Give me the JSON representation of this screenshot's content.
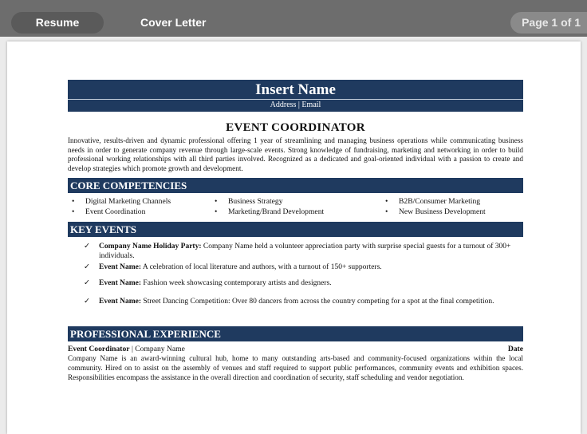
{
  "toolbar": {
    "tab_resume": "Resume",
    "tab_cover_letter": "Cover Letter",
    "page_indicator": "Page 1 of 1"
  },
  "resume": {
    "name": "Insert Name",
    "address_email": "Address | Email",
    "title": "EVENT COORDINATOR",
    "summary": "Innovative, results-driven and dynamic professional offering 1 year of streamlining and managing business operations while communicating business needs in order to generate company revenue through large-scale events. Strong knowledge of fundraising, marketing and networking in order to build professional working relationships with all third parties involved. Recognized as a dedicated and goal-oriented individual with a passion to create and develop strategies which promote growth and development.",
    "core_heading": "CORE COMPETENCIES",
    "competencies": [
      [
        "Digital Marketing Channels",
        "Event Coordination"
      ],
      [
        "Business Strategy",
        "Marketing/Brand Development"
      ],
      [
        "B2B/Consumer Marketing",
        "New Business Development"
      ]
    ],
    "events_heading": "KEY EVENTS",
    "events": [
      {
        "bold": "Company Name Holiday Party:",
        "text": " Company Name held a volunteer appreciation party with surprise special guests for a turnout of 300+ individuals."
      },
      {
        "bold": "Event Name:",
        "text": " A celebration of local literature and authors, with a turnout of 150+ supporters."
      },
      {
        "bold": "Event Name:",
        "text": " Fashion week showcasing contemporary artists and designers."
      },
      {
        "bold": "Event Name:",
        "text": " Street Dancing Competition: Over 80 dancers from across the country competing for a spot at the final competition."
      }
    ],
    "experience_heading": "PROFESSIONAL EXPERIENCE",
    "job": {
      "role": "Event Coordinator",
      "company": " | Company Name",
      "date": "Date",
      "description": "Company Name is an award-winning cultural hub, home to many outstanding arts-based and community-focused organizations within the local community. Hired on to assist on the assembly of venues and staff required to support public performances, community events and exhibition spaces. Responsibilities encompass the assistance in the overall direction and coordination of security, staff scheduling and vendor negotiation."
    }
  }
}
